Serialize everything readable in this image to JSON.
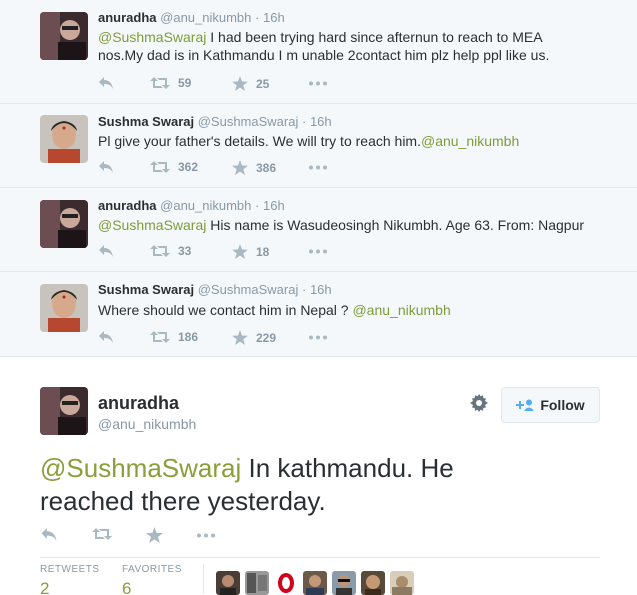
{
  "thread": [
    {
      "author": "anuradha",
      "screen_name": "@anu_nikumbh",
      "dot": "·",
      "time": "16h",
      "mention": "@SushmaSwaraj",
      "text_line1": " I had been trying hard since afternun to reach to MEA",
      "text_line2": "nos.My dad is in Kathmandu I m unable 2contact him plz help ppl like us.",
      "retweets": "59",
      "favorites": "25"
    },
    {
      "author": "Sushma Swaraj",
      "screen_name": "@SushmaSwaraj",
      "dot": "·",
      "time": "16h",
      "text": "Pl give your father's details. We will try to reach him.",
      "mention": "@anu_nikumbh",
      "retweets": "362",
      "favorites": "386"
    },
    {
      "author": "anuradha",
      "screen_name": "@anu_nikumbh",
      "dot": "·",
      "time": "16h",
      "mention": "@SushmaSwaraj",
      "text": " His name is Wasudeosingh Nikumbh. Age 63. From: Nagpur",
      "retweets": "33",
      "favorites": "18"
    },
    {
      "author": "Sushma Swaraj",
      "screen_name": "@SushmaSwaraj",
      "dot": "·",
      "time": "16h",
      "text": "Where should we contact him in Nepal ? ",
      "mention": "@anu_nikumbh",
      "retweets": "186",
      "favorites": "229"
    }
  ],
  "focused": {
    "author": "anuradha",
    "screen_name": "@anu_nikumbh",
    "follow_label": "Follow",
    "mention": "@SushmaSwaraj",
    "text_after_mention": " In kathmandu. He",
    "text_line2": "reached there yesterday.",
    "retweets_label": "RETWEETS",
    "retweets": "2",
    "favorites_label": "FAVORITES",
    "favorites": "6"
  },
  "colors": {
    "mention": "#8a9e3a",
    "meta": "#8899a6",
    "text": "#292f33",
    "thread_bg": "#f5f8fa"
  },
  "icons": [
    "reply-icon",
    "retweet-icon",
    "favorite-icon",
    "more-icon",
    "gear-icon",
    "follow-user-icon"
  ]
}
